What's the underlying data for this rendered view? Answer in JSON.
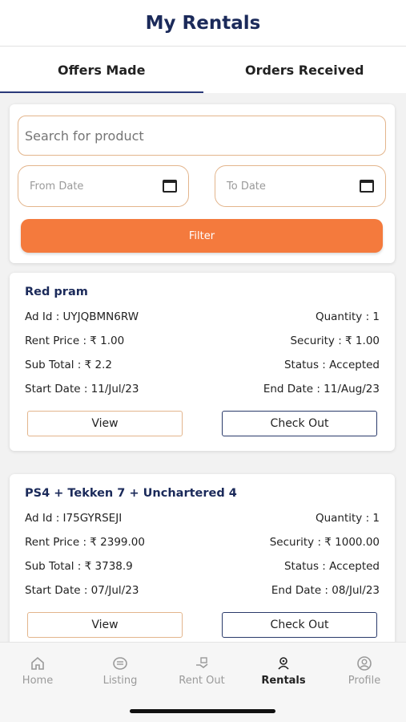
{
  "header": {
    "title": "My Rentals"
  },
  "tabs": [
    {
      "label": "Offers Made",
      "active": true
    },
    {
      "label": "Orders Received",
      "active": false
    }
  ],
  "filter": {
    "search_placeholder": "Search for product",
    "from_date_placeholder": "From Date",
    "to_date_placeholder": "To Date",
    "filter_label": "Filter"
  },
  "orders": [
    {
      "title": "Red pram",
      "ad_id": "Ad Id : UYJQBMN6RW",
      "quantity": "Quantity : 1",
      "rent_price": "Rent Price : ₹ 1.00",
      "security": "Security : ₹ 1.00",
      "sub_total": "Sub Total : ₹ 2.2",
      "status": "Status : Accepted",
      "start_date": "Start Date : 11/Jul/23",
      "end_date": "End Date : 11/Aug/23",
      "view_label": "View",
      "checkout_label": "Check Out"
    },
    {
      "title": "PS4 + Tekken 7 + Unchartered 4",
      "ad_id": "Ad Id : I75GYRSEJI",
      "quantity": "Quantity : 1",
      "rent_price": "Rent Price : ₹ 2399.00",
      "security": "Security : ₹ 1000.00",
      "sub_total": "Sub Total : ₹ 3738.9",
      "status": "Status : Accepted",
      "start_date": "Start Date : 07/Jul/23",
      "end_date": "End Date : 08/Jul/23",
      "view_label": "View",
      "checkout_label": "Check Out"
    }
  ],
  "bottom_nav": [
    {
      "label": "Home",
      "icon": "home-icon",
      "active": false
    },
    {
      "label": "Listing",
      "icon": "listing-icon",
      "active": false
    },
    {
      "label": "Rent Out",
      "icon": "rent-out-icon",
      "active": false
    },
    {
      "label": "Rentals",
      "icon": "rentals-icon",
      "active": true
    },
    {
      "label": "Profile",
      "icon": "profile-icon",
      "active": false
    }
  ],
  "colors": {
    "accent": "#f47a3d",
    "title_navy": "#1b2a5a",
    "field_border": "#e3b58c"
  }
}
